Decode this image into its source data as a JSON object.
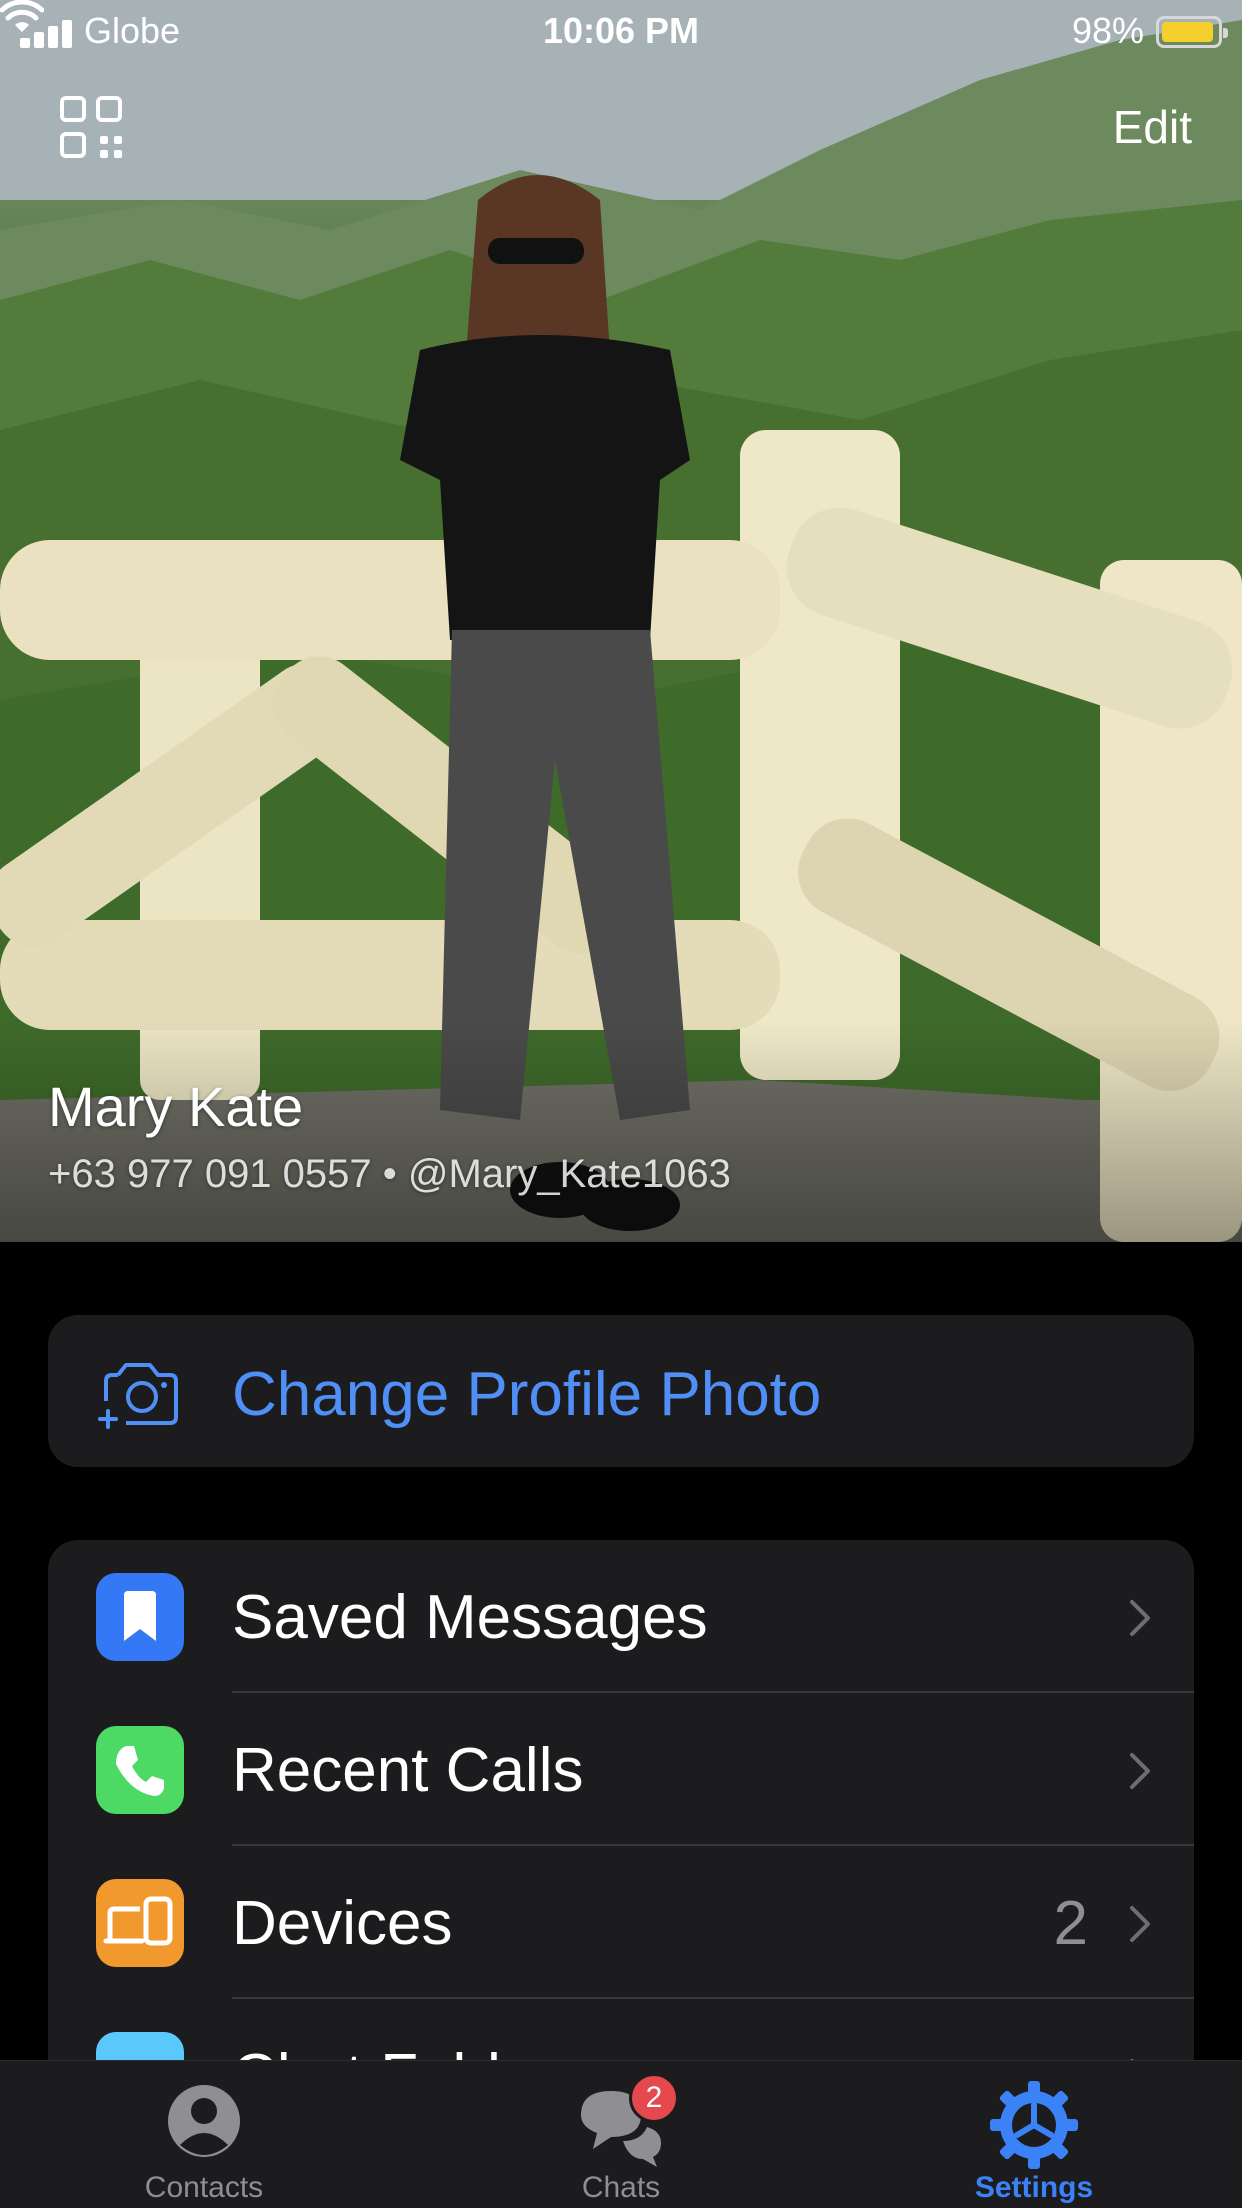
{
  "status_bar": {
    "carrier": "Globe",
    "time": "10:06 PM",
    "battery": "98%"
  },
  "header": {
    "edit_label": "Edit",
    "qr_icon": "qr-code-icon"
  },
  "profile": {
    "name": "Mary Kate",
    "phone_username": "+63 977 091 0557 • @Mary_Kate1063"
  },
  "photo_card": {
    "label": "Change Profile Photo",
    "icon": "camera-add-icon",
    "color": "#4f8ff7"
  },
  "menu": {
    "items": [
      {
        "label": "Saved Messages",
        "icon": "bookmark-icon",
        "color": "#3478f6",
        "value": ""
      },
      {
        "label": "Recent Calls",
        "icon": "phone-icon",
        "color": "#4cd964",
        "value": ""
      },
      {
        "label": "Devices",
        "icon": "devices-icon",
        "color": "#f2992e",
        "value": "2"
      },
      {
        "label": "Chat Folders",
        "icon": "folder-icon",
        "color": "#5ac8fa",
        "value": ""
      }
    ]
  },
  "tabbar": {
    "tabs": [
      {
        "label": "Contacts",
        "icon": "person-circle-icon"
      },
      {
        "label": "Chats",
        "icon": "chat-bubbles-icon",
        "badge": "2"
      },
      {
        "label": "Settings",
        "icon": "gear-icon",
        "active": true
      }
    ],
    "active_color": "#3b82f6"
  }
}
